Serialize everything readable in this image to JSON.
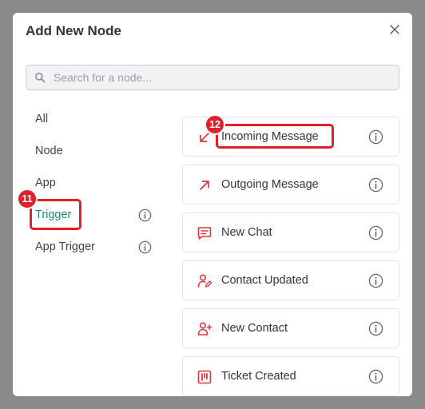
{
  "dialog": {
    "title": "Add New Node",
    "close_icon": "close-icon"
  },
  "search": {
    "placeholder": "Search for a node...",
    "value": "",
    "icon": "search-icon"
  },
  "categories": [
    {
      "label": "All",
      "active": false,
      "info": false
    },
    {
      "label": "Node",
      "active": false,
      "info": false
    },
    {
      "label": "App",
      "active": false,
      "info": false
    },
    {
      "label": "Trigger",
      "active": true,
      "info": true
    },
    {
      "label": "App Trigger",
      "active": false,
      "info": true
    }
  ],
  "nodes": [
    {
      "label": "Incoming Message",
      "icon": "arrow-down-left-icon"
    },
    {
      "label": "Outgoing Message",
      "icon": "arrow-up-right-icon"
    },
    {
      "label": "New Chat",
      "icon": "chat-message-icon"
    },
    {
      "label": "Contact Updated",
      "icon": "user-edit-icon"
    },
    {
      "label": "New Contact",
      "icon": "user-plus-icon"
    },
    {
      "label": "Ticket Created",
      "icon": "kanban-ticket-icon"
    }
  ],
  "annotations": [
    {
      "number": "11",
      "target": "Trigger"
    },
    {
      "number": "12",
      "target": "Incoming Message"
    }
  ],
  "colors": {
    "accent": "#1f8a7c",
    "icon_red": "#e0363f",
    "highlight": "#e0202a",
    "text": "#2f3542"
  }
}
